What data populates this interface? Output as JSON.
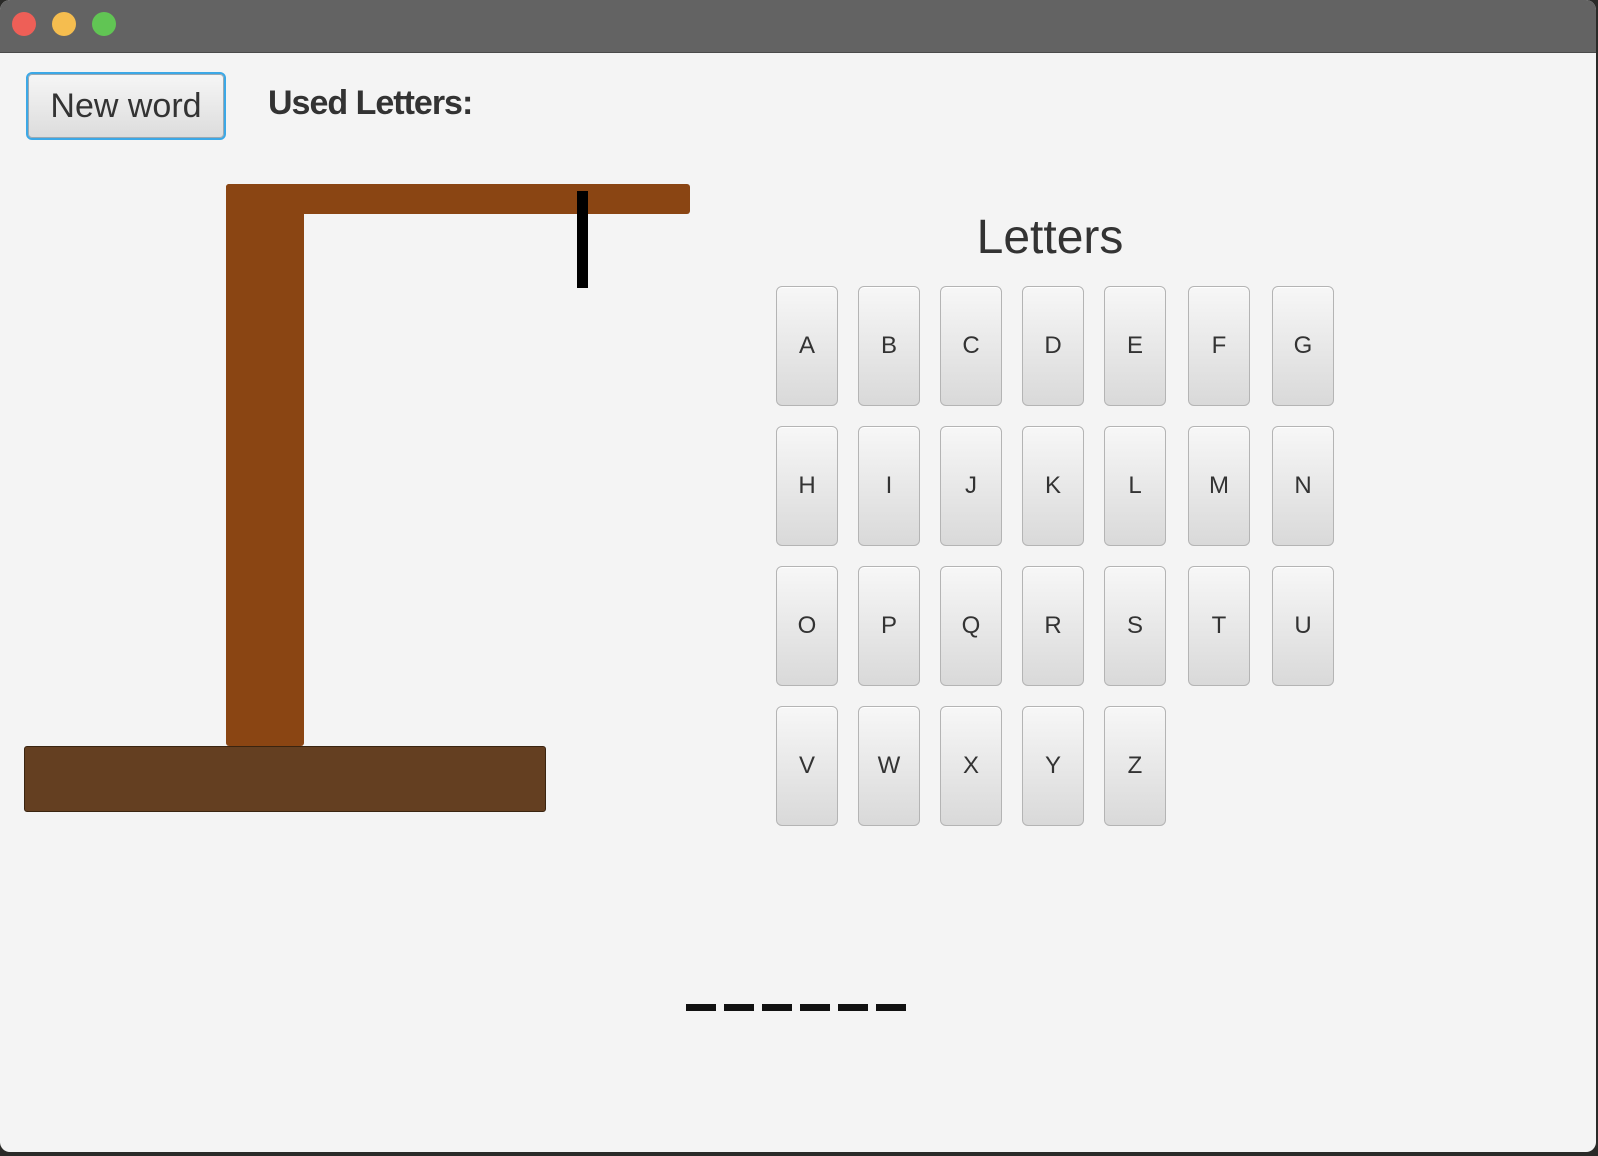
{
  "toolbar": {
    "new_word_label": "New word",
    "used_letters_label": "Used Letters:",
    "used_letters_value": ""
  },
  "keyboard": {
    "title": "Letters",
    "letters": [
      "A",
      "B",
      "C",
      "D",
      "E",
      "F",
      "G",
      "H",
      "I",
      "J",
      "K",
      "L",
      "M",
      "N",
      "O",
      "P",
      "Q",
      "R",
      "S",
      "T",
      "U",
      "V",
      "W",
      "X",
      "Y",
      "Z"
    ]
  },
  "word": {
    "length": 6
  },
  "colors": {
    "gallows_wood": "#8a4513",
    "gallows_base": "#643f21",
    "rope": "#000000",
    "focus_ring": "#3ca8e6"
  }
}
